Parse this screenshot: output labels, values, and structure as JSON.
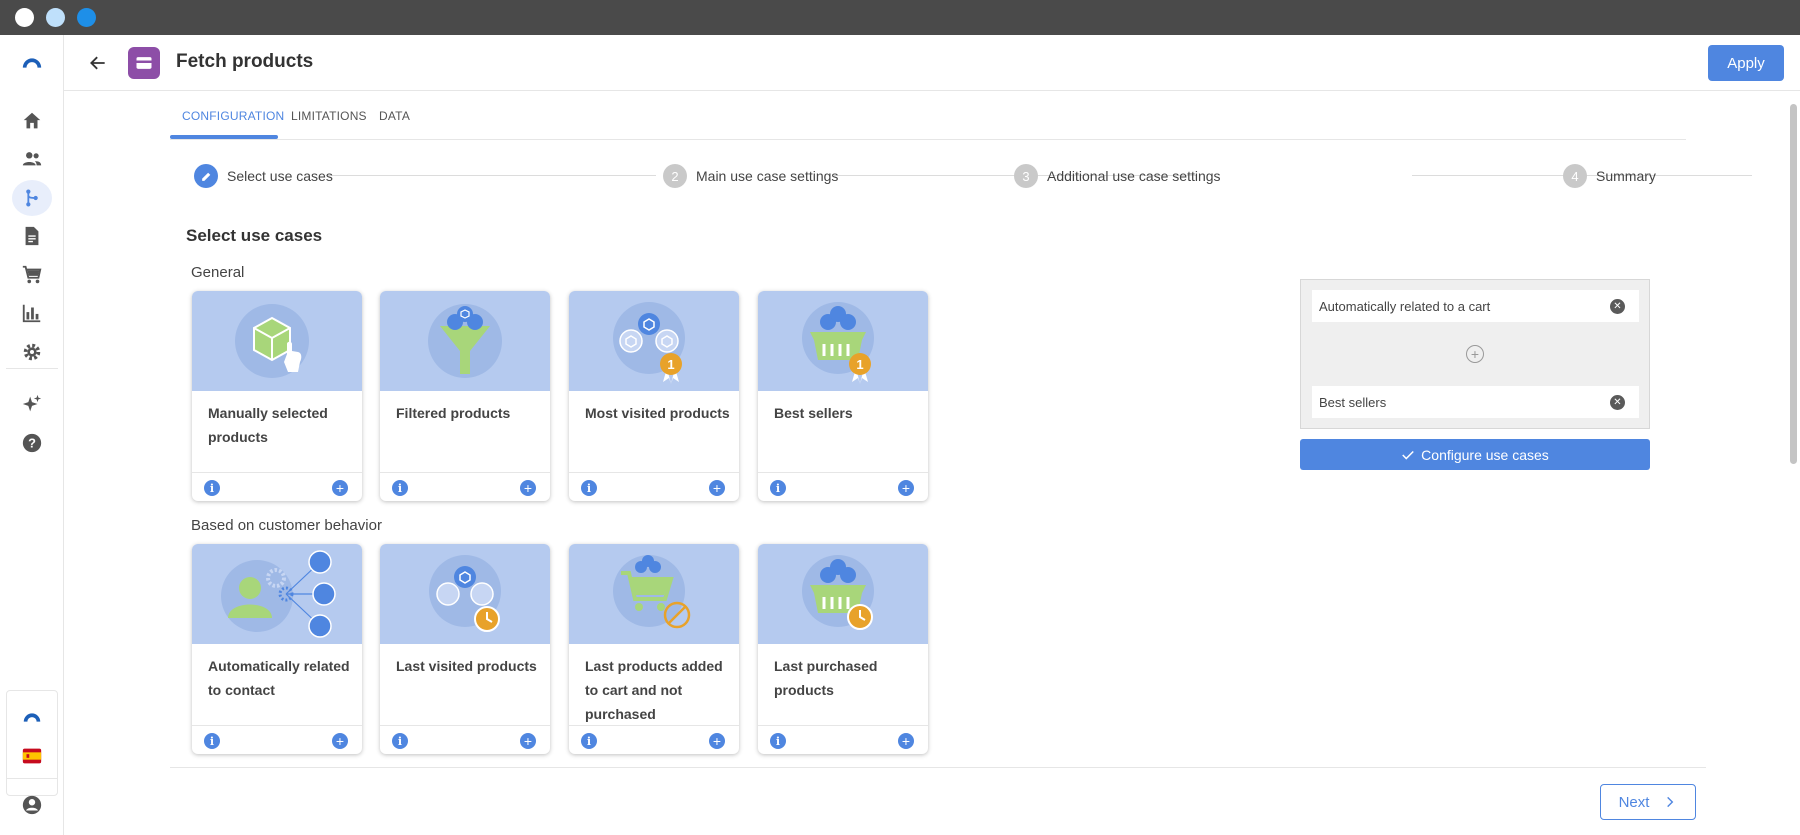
{
  "window": {
    "controls": [
      "close",
      "minimize",
      "maximize"
    ]
  },
  "rail": {
    "items": [
      {
        "icon": "home-icon",
        "active": false
      },
      {
        "icon": "people-icon",
        "active": false
      },
      {
        "icon": "flow-icon",
        "active": true
      },
      {
        "icon": "document-icon",
        "active": false
      },
      {
        "icon": "cart-icon",
        "active": false
      },
      {
        "icon": "chart-icon",
        "active": false
      },
      {
        "icon": "gear-icon",
        "active": false
      },
      {
        "icon": "sparkle-icon",
        "active": false
      },
      {
        "icon": "help-icon",
        "active": false
      }
    ],
    "bottom": [
      "brand-icon",
      "spain-flag-icon",
      "user-icon"
    ]
  },
  "header": {
    "title": "Fetch products",
    "apply_label": "Apply"
  },
  "tabs": [
    "CONFIGURATION",
    "LIMITATIONS",
    "DATA"
  ],
  "stepper": {
    "steps": [
      {
        "num": "",
        "label": "Select use cases"
      },
      {
        "num": "2",
        "label": "Main use case settings"
      },
      {
        "num": "3",
        "label": "Additional use case settings"
      },
      {
        "num": "4",
        "label": "Summary"
      }
    ]
  },
  "section_title": "Select use cases",
  "groups": {
    "general": {
      "label": "General",
      "cards": [
        {
          "title": "Manually selected products"
        },
        {
          "title": "Filtered products"
        },
        {
          "title": "Most visited products"
        },
        {
          "title": "Best sellers"
        }
      ]
    },
    "behavior": {
      "label": "Based on customer behavior",
      "cards": [
        {
          "title": "Automatically related to contact"
        },
        {
          "title": "Last visited products"
        },
        {
          "title": "Last products added to cart and not purchased"
        },
        {
          "title": "Last purchased products"
        }
      ]
    }
  },
  "selected": {
    "items": [
      "Automatically related to a cart",
      "Best sellers"
    ],
    "configure_label": "Configure use cases"
  },
  "footer": {
    "next_label": "Next"
  },
  "colors": {
    "accent": "#4f86e0",
    "card_bg": "#b5caef",
    "node_purple": "#8d4ea7"
  }
}
